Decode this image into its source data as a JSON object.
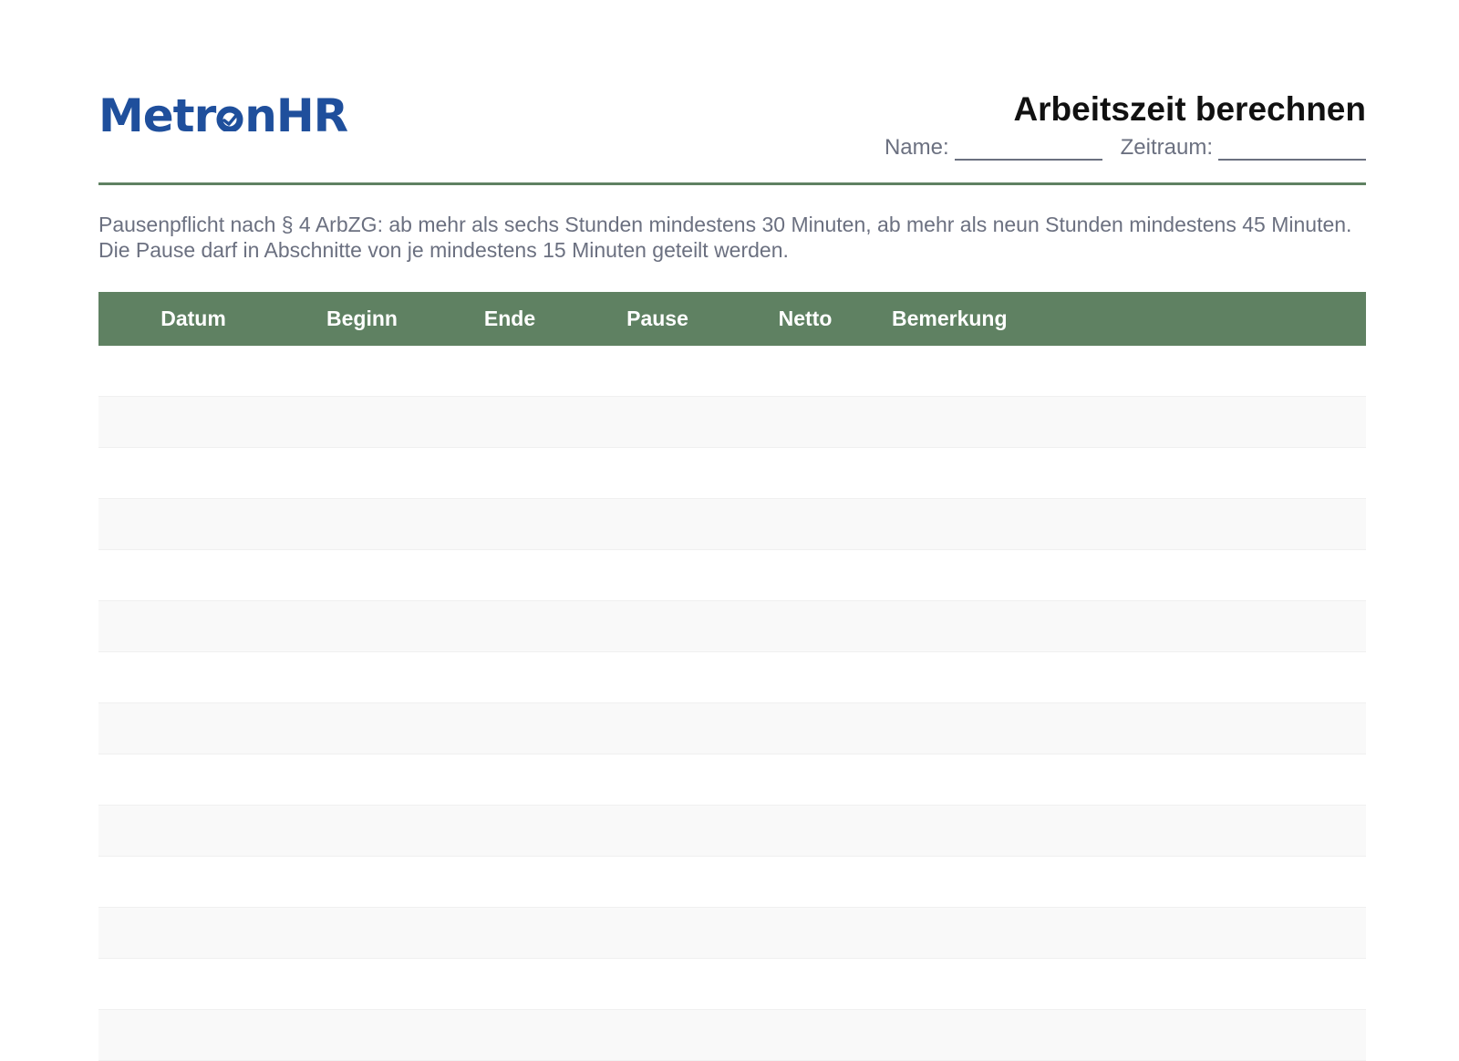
{
  "brand": {
    "logo_text": "MetronHR",
    "logo_color": "#1f4f9c"
  },
  "header": {
    "title": "Arbeitszeit berechnen",
    "name_label": "Name:",
    "period_label": "Zeitraum:"
  },
  "note": "Pausenpflicht nach § 4 ArbZG: ab mehr als sechs Stunden mindestens 30 Minuten, ab mehr als neun Stunden mindestens 45 Minuten. Die Pause darf in Abschnitte von je mindestens 15 Minuten geteilt werden.",
  "table": {
    "columns": [
      "Datum",
      "Beginn",
      "Ende",
      "Pause",
      "Netto",
      "Bemerkung"
    ],
    "header_color": "#5f8162",
    "empty_row_count": 14
  },
  "colors": {
    "accent": "#5f8162",
    "muted_text": "#6b7080",
    "title_text": "#111111"
  }
}
